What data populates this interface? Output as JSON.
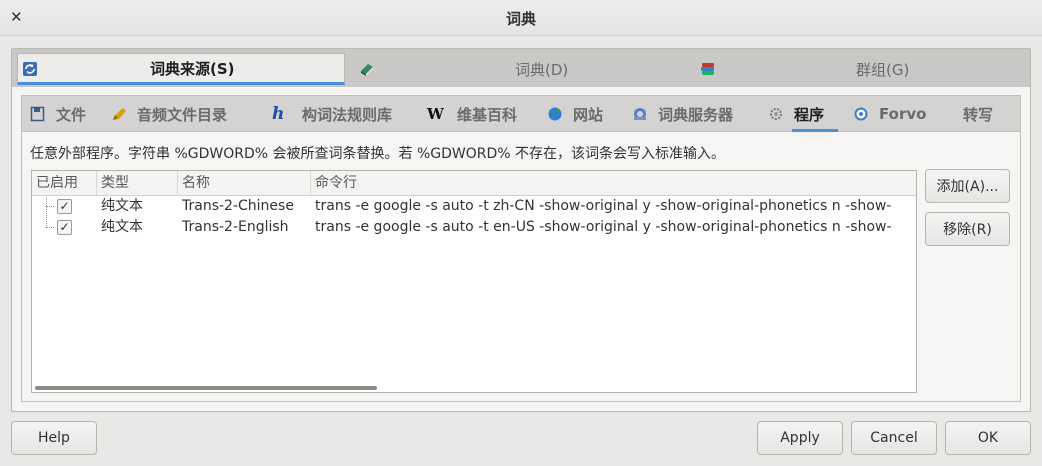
{
  "window": {
    "title": "词典",
    "close_glyph": "✕"
  },
  "top_tabs": [
    {
      "label": "词典来源(S)",
      "icon": "refresh-icon",
      "active": true
    },
    {
      "label": "词典(D)",
      "icon": "book-icon",
      "active": false
    },
    {
      "label": "群组(G)",
      "icon": "books-stack-icon",
      "active": false
    }
  ],
  "sub_tabs": [
    {
      "label": "文件",
      "icon": "floppy-icon",
      "glyph": "🖫"
    },
    {
      "label": "音频文件目录",
      "icon": "pencil-icon",
      "glyph": "✎"
    },
    {
      "label": "构词法规则库",
      "icon": "h-letter-icon",
      "glyph": "h"
    },
    {
      "label": "维基百科",
      "icon": "wikipedia-icon",
      "glyph": "W"
    },
    {
      "label": "网站",
      "icon": "globe-icon",
      "glyph": "◉"
    },
    {
      "label": "词典服务器",
      "icon": "server-icon",
      "glyph": "◍"
    },
    {
      "label": "程序",
      "icon": "gear-icon",
      "glyph": "⚙",
      "active": true
    },
    {
      "label": "Forvo",
      "icon": "forvo-icon",
      "glyph": "◎"
    },
    {
      "label": "转写",
      "icon": "",
      "glyph": ""
    }
  ],
  "description": "任意外部程序。字符串 %GDWORD% 会被所查词条替换。若 %GDWORD% 不存在，该词条会写入标准输入。",
  "table": {
    "headers": [
      "已启用",
      "类型",
      "名称",
      "命令行"
    ],
    "rows": [
      {
        "enabled": true,
        "type": "纯文本",
        "name": "Trans-2-Chinese",
        "command": "trans -e google -s auto -t zh-CN -show-original y -show-original-phonetics n -show-"
      },
      {
        "enabled": true,
        "type": "纯文本",
        "name": "Trans-2-English",
        "command": "trans -e google -s auto -t en-US -show-original y -show-original-phonetics n -show-"
      }
    ]
  },
  "side_buttons": {
    "add": "添加(A)...",
    "remove": "移除(R)"
  },
  "bottom_buttons": {
    "help": "Help",
    "apply": "Apply",
    "cancel": "Cancel",
    "ok": "OK"
  },
  "colors": {
    "accent": "#4a90d9",
    "tab_bar": "#c9c8c6",
    "window_bg": "#e8e8e7"
  }
}
